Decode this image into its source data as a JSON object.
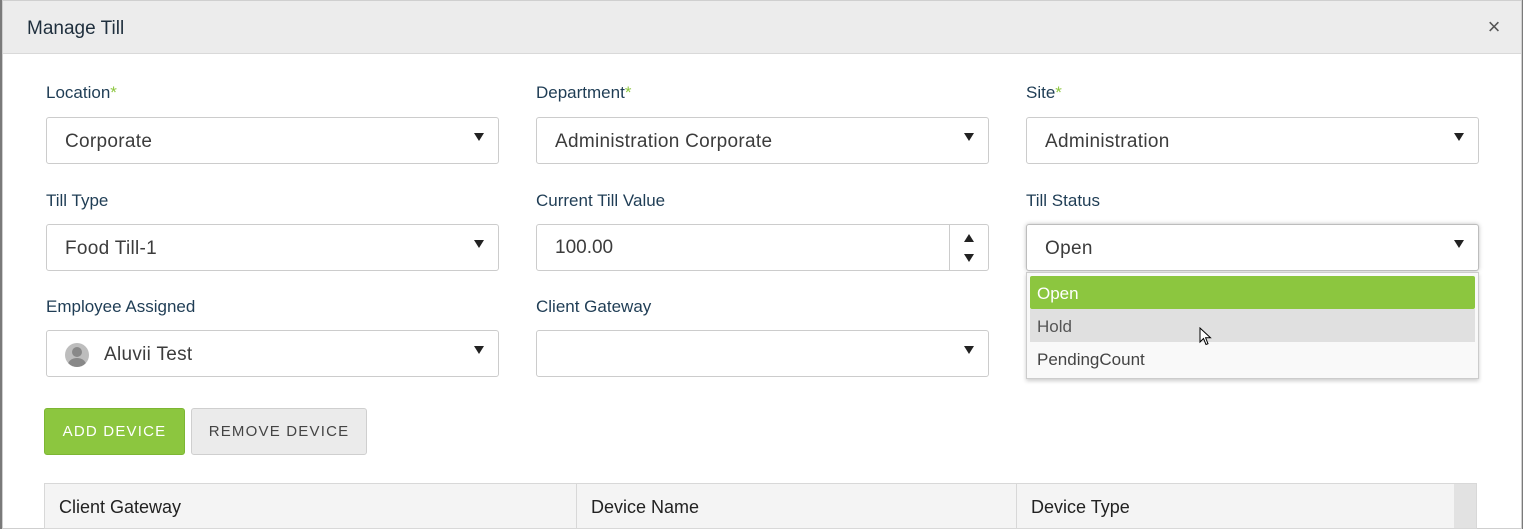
{
  "modal": {
    "title": "Manage Till",
    "close_label": "×"
  },
  "fields": {
    "location": {
      "label": "Location",
      "required": "*",
      "value": "Corporate"
    },
    "department": {
      "label": "Department",
      "required": "*",
      "value": "Administration Corporate"
    },
    "site": {
      "label": "Site",
      "required": "*",
      "value": "Administration"
    },
    "till_type": {
      "label": "Till Type",
      "value": "Food Till-1"
    },
    "current_till_value": {
      "label": "Current Till Value",
      "value": "100.00"
    },
    "till_status": {
      "label": "Till Status",
      "value": "Open",
      "options": [
        "Open",
        "Hold",
        "PendingCount"
      ]
    },
    "employee_assigned": {
      "label": "Employee Assigned",
      "value": "Aluvii Test"
    },
    "client_gateway": {
      "label": "Client Gateway",
      "value": ""
    }
  },
  "buttons": {
    "add_device": "ADD DEVICE",
    "remove_device": "REMOVE DEVICE"
  },
  "table": {
    "columns": [
      "Client Gateway",
      "Device Name",
      "Device Type"
    ]
  },
  "colors": {
    "accent": "#8cc63f",
    "header_bg": "#ececec",
    "label": "#1f3d55"
  },
  "icons": {
    "close": "close-icon",
    "caret": "chevron-down-icon",
    "avatar": "user-avatar-icon",
    "cursor": "mouse-pointer-icon"
  }
}
